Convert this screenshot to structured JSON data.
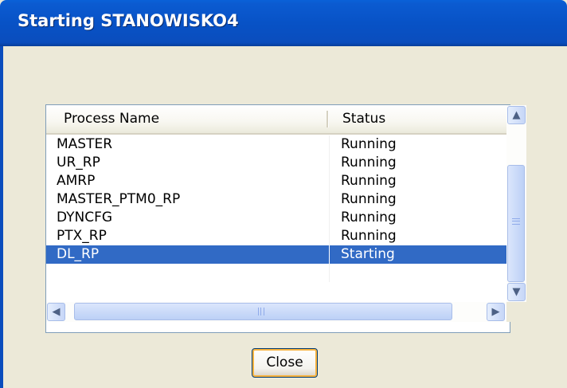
{
  "window": {
    "title": "Starting STANOWISKO4"
  },
  "list": {
    "columns": {
      "name": "Process Name",
      "status": "Status"
    },
    "rows": [
      {
        "name": "MASTER",
        "status": "Running"
      },
      {
        "name": "UR_RP",
        "status": "Running"
      },
      {
        "name": "AMRP",
        "status": "Running"
      },
      {
        "name": "MASTER_PTM0_RP",
        "status": "Running"
      },
      {
        "name": "DYNCFG",
        "status": "Running"
      },
      {
        "name": "PTX_RP",
        "status": "Running"
      },
      {
        "name": "DL_RP",
        "status": "Starting"
      }
    ],
    "selected_row": "DL_RP"
  },
  "buttons": {
    "close_label": "Close"
  },
  "icons": {
    "scroll_up": "chevron-up-icon",
    "scroll_down": "chevron-down-icon",
    "scroll_left": "chevron-left-icon",
    "scroll_right": "chevron-right-icon"
  },
  "colors": {
    "titlebar": "#0a4dbd",
    "selection": "#316ac5",
    "dialog_bg": "#ece9d8"
  }
}
